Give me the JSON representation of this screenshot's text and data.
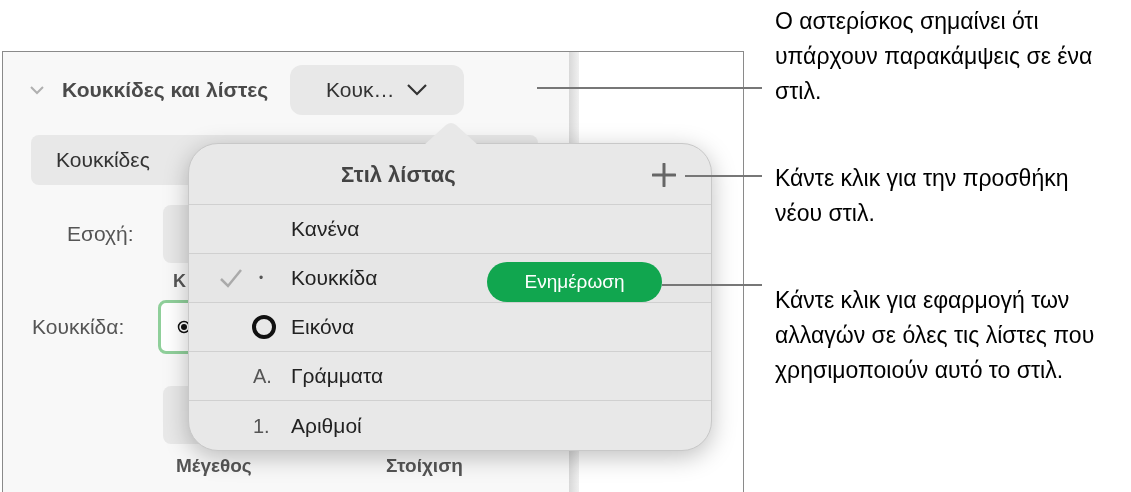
{
  "panel": {
    "section": {
      "title": "Κουκκίδες και λίστες",
      "expanded": true
    },
    "style_button": {
      "label": "Κουκ…"
    },
    "preset_button": {
      "label": "Κουκκίδες"
    },
    "indent_label": "Εσοχή:",
    "column_heading": "Κ",
    "bullet_label": "Κουκκίδα:",
    "footer_labels": [
      "Μέγεθος",
      "Στοίχιση"
    ]
  },
  "popover": {
    "title": "Στιλ λίστας",
    "update_button": "Ενημέρωση",
    "items": [
      {
        "kind": "none",
        "label": "Κανένα",
        "selected": false
      },
      {
        "kind": "text",
        "marker": "•",
        "label": "Κουκκίδα",
        "selected": true
      },
      {
        "kind": "image",
        "label": "Εικόνα",
        "selected": false
      },
      {
        "kind": "text",
        "marker": "A.",
        "label": "Γράμματα",
        "selected": false
      },
      {
        "kind": "text",
        "marker": "1.",
        "label": "Αριθμοί",
        "selected": false
      }
    ]
  },
  "callouts": [
    "Ο αστερίσκος σημαίνει ότι υπάρχουν παρακάμψεις σε ένα στιλ.",
    "Κάντε κλικ για την προσθήκη νέου στιλ.",
    "Κάντε κλικ για εφαρμογή των αλλαγών σε όλες τις λίστες που χρησιμοποιούν αυτό το στιλ."
  ]
}
